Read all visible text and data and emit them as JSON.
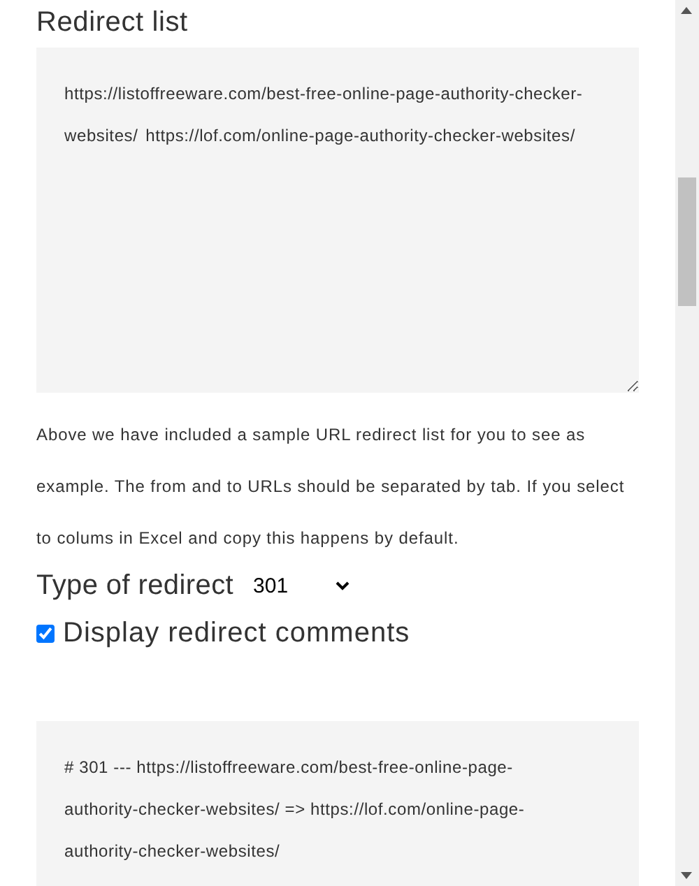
{
  "heading": "Redirect list",
  "redirect_list": {
    "value": "https://listoffreeware.com/best-free-online-page-authority-checker-websites/\thttps://lof.com/online-page-authority-checker-websites/"
  },
  "description": "Above we have included a sample URL redirect list for you to see as example. The from and to URLs should be separated by tab. If you select to colums in Excel and copy this happens by default.",
  "redirect_type": {
    "label": "Type of redirect",
    "value": "301"
  },
  "display_comments": {
    "label": "Display redirect comments",
    "checked": true
  },
  "output": {
    "value": "# 301 --- https://listoffreeware.com/best-free-online-page-authority-checker-websites/ => https://lof.com/online-page-authority-checker-websites/"
  }
}
